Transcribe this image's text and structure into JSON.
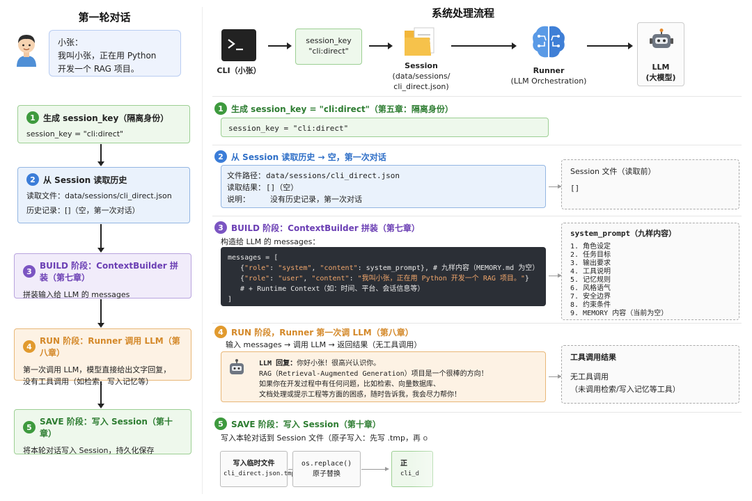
{
  "left": {
    "title": "第一轮对话",
    "bubble": [
      "小张：",
      "我叫小张，正在用 Python",
      "开发一个 RAG 项目。"
    ],
    "steps": [
      {
        "num": "1",
        "title": "生成 session_key（隔离身份）",
        "lines": [
          "session_key = \"cli:direct\""
        ]
      },
      {
        "num": "2",
        "title": "从 Session 读取历史",
        "lines": [
          "读取文件：data/sessions/cli_direct.json",
          "历史记录：[]（空，第一次对话）"
        ]
      },
      {
        "num": "3",
        "title": "BUILD 阶段：ContextBuilder 拼装（第七章）",
        "lines": [
          "拼装输入给 LLM 的 messages"
        ]
      },
      {
        "num": "4",
        "title": "RUN 阶段：Runner 调用 LLM（第八章）",
        "lines": [
          "第一次调用 LLM，模型直接给出文字回复，",
          "没有工具调用（如检索、写入记忆等）"
        ]
      },
      {
        "num": "5",
        "title": "SAVE 阶段：写入 Session（第十章）",
        "lines": [
          "将本轮对话写入 Session，持久化保存"
        ]
      }
    ]
  },
  "right": {
    "title": "系统处理流程",
    "flow": {
      "cli": "CLI（小张）",
      "key_box": [
        "session_key",
        "\"cli:direct\""
      ],
      "session": [
        "Session",
        "(data/sessions/",
        "cli_direct.json)"
      ],
      "runner": [
        "Runner",
        "(LLM Orchestration)"
      ],
      "llm": [
        "LLM",
        "(大模型)"
      ]
    },
    "sec1": {
      "num": "1",
      "title": "生成 session_key = \"cli:direct\"（第五章：隔离身份）",
      "code": "session_key = \"cli:direct\""
    },
    "sec2": {
      "num": "2",
      "title": "从 Session 读取历史 → 空，第一次对话",
      "rows": [
        {
          "label": "文件路径：",
          "value": "data/sessions/cli_direct.json"
        },
        {
          "label": "读取结果：",
          "value": "[]（空）"
        },
        {
          "label": "说明：",
          "value": "没有历史记录，第一次对话"
        }
      ],
      "side_title": "Session 文件（读取前）",
      "side_value": "[]"
    },
    "sec3": {
      "num": "3",
      "title": "BUILD 阶段：ContextBuilder 拼装（第七章）",
      "subtitle": "构造给 LLM 的 messages：",
      "code": {
        "open": "messages = [",
        "l1_pre": "{",
        "l1_k1": "\"role\"",
        "l1_v1": "\"system\"",
        "l1_k2": "\"content\"",
        "l1_rest": ": system_prompt}, # 九样内容（MEMORY.md 为空）",
        "l2_k1": "\"role\"",
        "l2_v1": "\"user\"",
        "l2_k2": "\"content\"",
        "l2_v2": "\"我叫小张，正在用 Python 开发一个 RAG 项目。\"",
        "l3": "# + Runtime Context（如：时间、平台、会话信息等）",
        "close": "]"
      },
      "side_title": "system_prompt（九样内容）",
      "side_items": [
        "1. 角色设定",
        "2. 任务目标",
        "3. 输出要求",
        "4. 工具说明",
        "5. 记忆规则",
        "6. 风格语气",
        "7. 安全边界",
        "8. 约束条件",
        "9. MEMORY 内容（当前为空）"
      ]
    },
    "sec4": {
      "num": "4",
      "title": "RUN 阶段，Runner 第一次调 LLM（第八章）",
      "subtitle": "输入 messages → 调用 LLM → 返回结果（无工具调用）",
      "reply_label": "LLM 回复：",
      "reply_lines": [
        "你好小张！很高兴认识你。",
        "RAG（Retrieval-Augmented Generation）项目是一个很棒的方向！",
        "如果你在开发过程中有任何问题，比如检索、向量数据库、",
        "文档处理或提示工程等方面的困惑，随时告诉我，我会尽力帮你！"
      ],
      "side_title": "工具调用结果",
      "side_lines": [
        "无工具调用",
        "（未调用检索/写入记忆等工具）"
      ]
    },
    "sec5": {
      "num": "5",
      "title": "SAVE 阶段：写入 Session（第十章）",
      "subtitle": "写入本轮对话到 Session 文件（原子写入：先写 .tmp，再 o",
      "box1": [
        "写入临时文件",
        "cli_direct.json.tmp"
      ],
      "box2": [
        "os.replace()",
        "原子替换"
      ],
      "box3": [
        "正",
        "cli_d"
      ]
    }
  }
}
